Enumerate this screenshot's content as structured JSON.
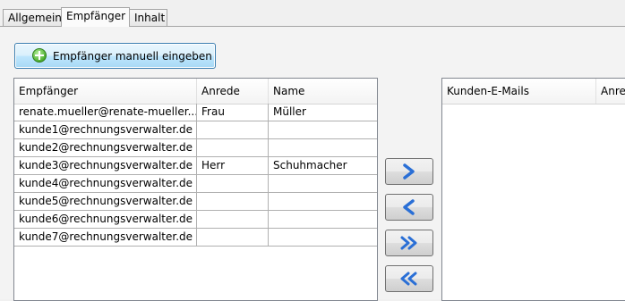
{
  "tabs": [
    {
      "label": "Allgemein"
    },
    {
      "label": "Empfänger"
    },
    {
      "label": "Inhalt"
    }
  ],
  "manual_button": {
    "label": "Empfänger manuell eingeben",
    "icon": "plus-circle-icon"
  },
  "recipients_table": {
    "columns": [
      "Empfänger",
      "Anrede",
      "Name"
    ],
    "rows": [
      [
        "renate.mueller@renate-mueller...",
        "Frau",
        "Müller"
      ],
      [
        "kunde1@rechnungsverwalter.de",
        "",
        ""
      ],
      [
        "kunde2@rechnungsverwalter.de",
        "",
        ""
      ],
      [
        "kunde3@rechnungsverwalter.de",
        "Herr",
        "Schuhmacher"
      ],
      [
        "kunde4@rechnungsverwalter.de",
        "",
        ""
      ],
      [
        "kunde5@rechnungsverwalter.de",
        "",
        ""
      ],
      [
        "kunde6@rechnungsverwalter.de",
        "",
        ""
      ],
      [
        "kunde7@rechnungsverwalter.de",
        "",
        ""
      ]
    ]
  },
  "customer_emails_table": {
    "columns": [
      "Kunden-E-Mails",
      "Anrede"
    ]
  },
  "move_buttons": [
    {
      "icon": "chevron-right-icon"
    },
    {
      "icon": "chevron-left-icon"
    },
    {
      "icon": "double-chevron-right-icon"
    },
    {
      "icon": "double-chevron-left-icon"
    }
  ],
  "colors": {
    "arrow": "#2a6fd6",
    "accent_border": "#3c7fb1"
  }
}
